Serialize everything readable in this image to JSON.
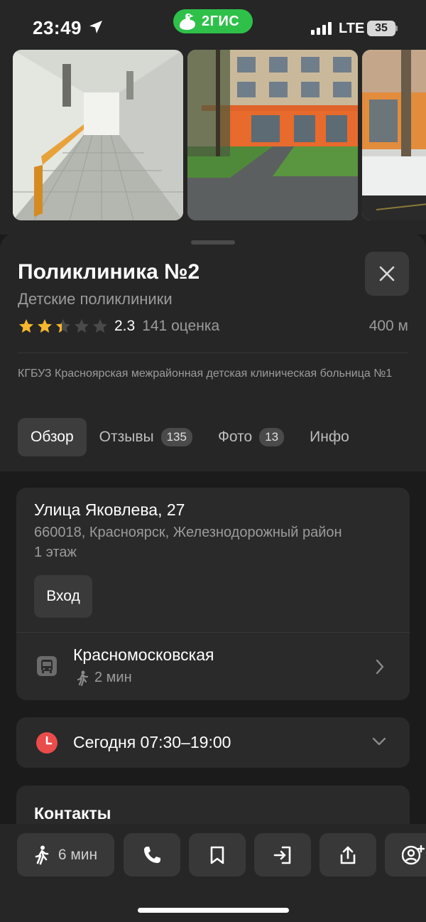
{
  "status_bar": {
    "time": "23:49",
    "brand": "2ГИС",
    "network": "LTE",
    "battery": "35"
  },
  "place": {
    "title": "Поликлиника №2",
    "category": "Детские поликлиники",
    "rating": "2.3",
    "rating_stars": 2.3,
    "rating_count": "141 оценка",
    "distance": "400 м",
    "org_name": "КГБУЗ Красноярская межрайонная детская клиническая больница №1"
  },
  "tabs": [
    {
      "label": "Обзор",
      "active": true
    },
    {
      "label": "Отзывы",
      "badge": "135"
    },
    {
      "label": "Фото",
      "badge": "13"
    },
    {
      "label": "Инфо"
    }
  ],
  "address": {
    "street": "Улица Яковлева, 27",
    "details": "660018, Красноярск, Железнодорожный район",
    "floor": "1 этаж",
    "entry_button": "Вход"
  },
  "transit": {
    "stop_name": "Красномосковская",
    "walk_time": "2 мин"
  },
  "hours": {
    "text": "Сегодня 07:30–19:00"
  },
  "contacts": {
    "title": "Контакты"
  },
  "actions": {
    "walk_time": "6 мин"
  },
  "colors": {
    "brand_green": "#2fc04a",
    "star_gold": "#f5b82e",
    "clock_red": "#ea4b4b"
  }
}
